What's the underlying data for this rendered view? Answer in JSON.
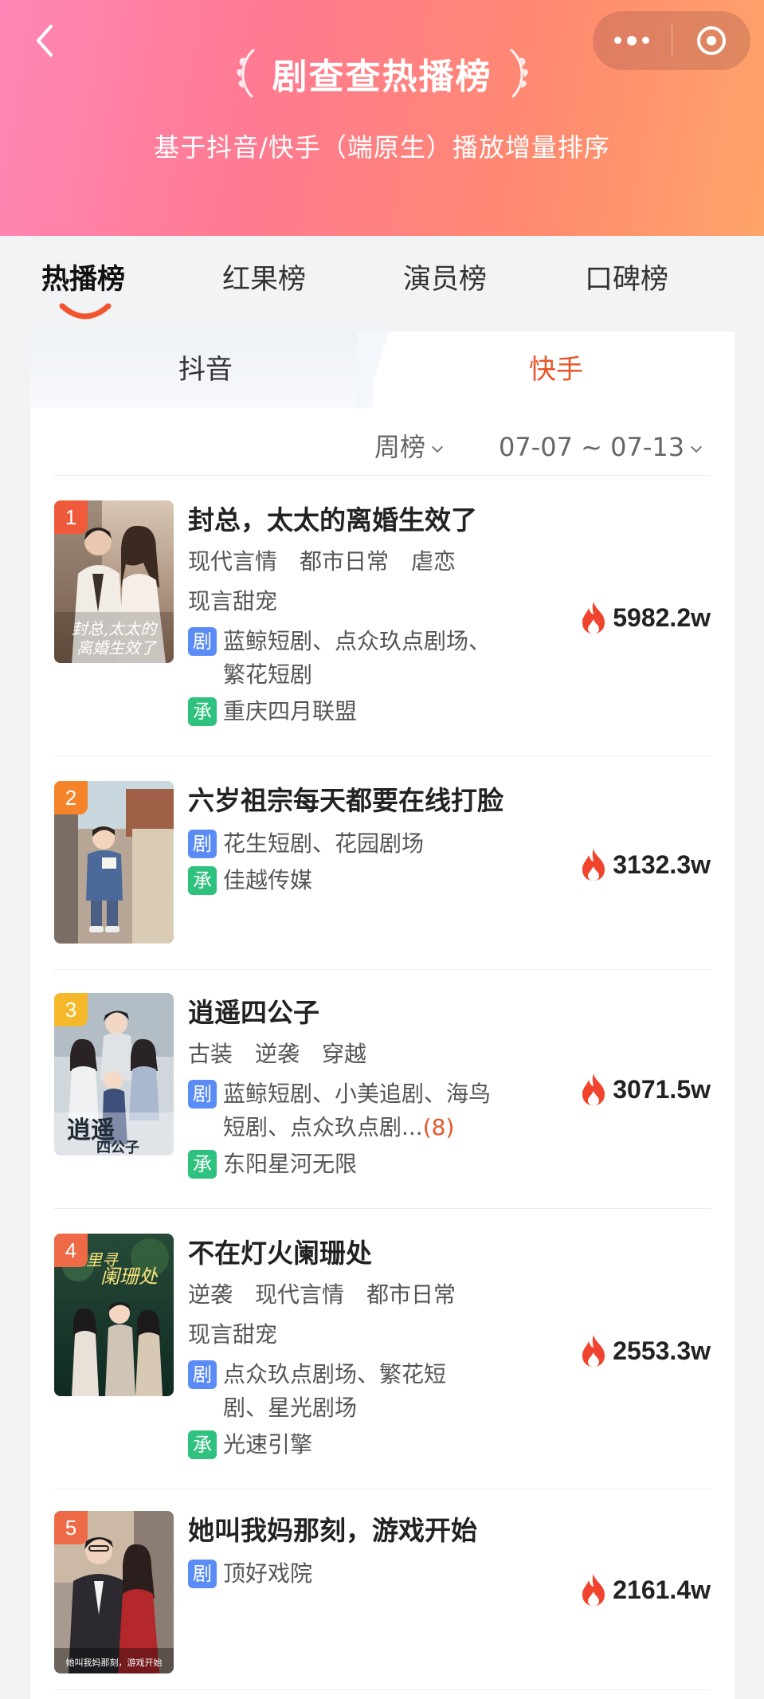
{
  "header": {
    "title": "剧查查热播榜",
    "subtitle": "基于抖音/快手（端原生）播放增量排序",
    "gradient": [
      "#ff86b6",
      "#ff7a90",
      "#ffa46a"
    ]
  },
  "main_tabs": [
    {
      "label": "热播榜",
      "active": true
    },
    {
      "label": "红果榜",
      "active": false
    },
    {
      "label": "演员榜",
      "active": false
    },
    {
      "label": "口碑榜",
      "active": false
    }
  ],
  "platform_tabs": [
    {
      "label": "抖音",
      "active": false
    },
    {
      "label": "快手",
      "active": true
    }
  ],
  "filters": {
    "period": "周榜",
    "date_range": "07-07 ~ 07-13"
  },
  "colors": {
    "accent": "#e8562a",
    "label_ju": "#5b8cf5",
    "label_cheng": "#2ec27e"
  },
  "label_ju_text": "剧",
  "label_cheng_text": "承",
  "dramas": [
    {
      "rank": "1",
      "title": "封总，太太的离婚生效了",
      "tags": [
        "现代言情",
        "都市日常",
        "虐恋",
        "现言甜宠"
      ],
      "platforms": "蓝鲸短剧、点众玖点剧场、繁花短剧",
      "more": "",
      "producer": "重庆四月联盟",
      "heat": "5982.2w"
    },
    {
      "rank": "2",
      "title": "六岁祖宗每天都要在线打脸",
      "tags": [],
      "platforms": "花生短剧、花园剧场",
      "more": "",
      "producer": "佳越传媒",
      "heat": "3132.3w"
    },
    {
      "rank": "3",
      "title": "逍遥四公子",
      "tags": [
        "古装",
        "逆袭",
        "穿越"
      ],
      "platforms": "蓝鲸短剧、小美追剧、海鸟短剧、点众玖点剧...",
      "more": "(8)",
      "producer": "东阳星河无限",
      "heat": "3071.5w"
    },
    {
      "rank": "4",
      "title": "不在灯火阑珊处",
      "tags": [
        "逆袭",
        "现代言情",
        "都市日常",
        "现言甜宠"
      ],
      "platforms": "点众玖点剧场、繁花短剧、星光剧场",
      "more": "",
      "producer": "光速引擎",
      "heat": "2553.3w"
    },
    {
      "rank": "5",
      "title": "她叫我妈那刻，游戏开始",
      "tags": [],
      "platforms": "顶好戏院",
      "more": "",
      "producer": "",
      "heat": "2161.4w"
    }
  ]
}
